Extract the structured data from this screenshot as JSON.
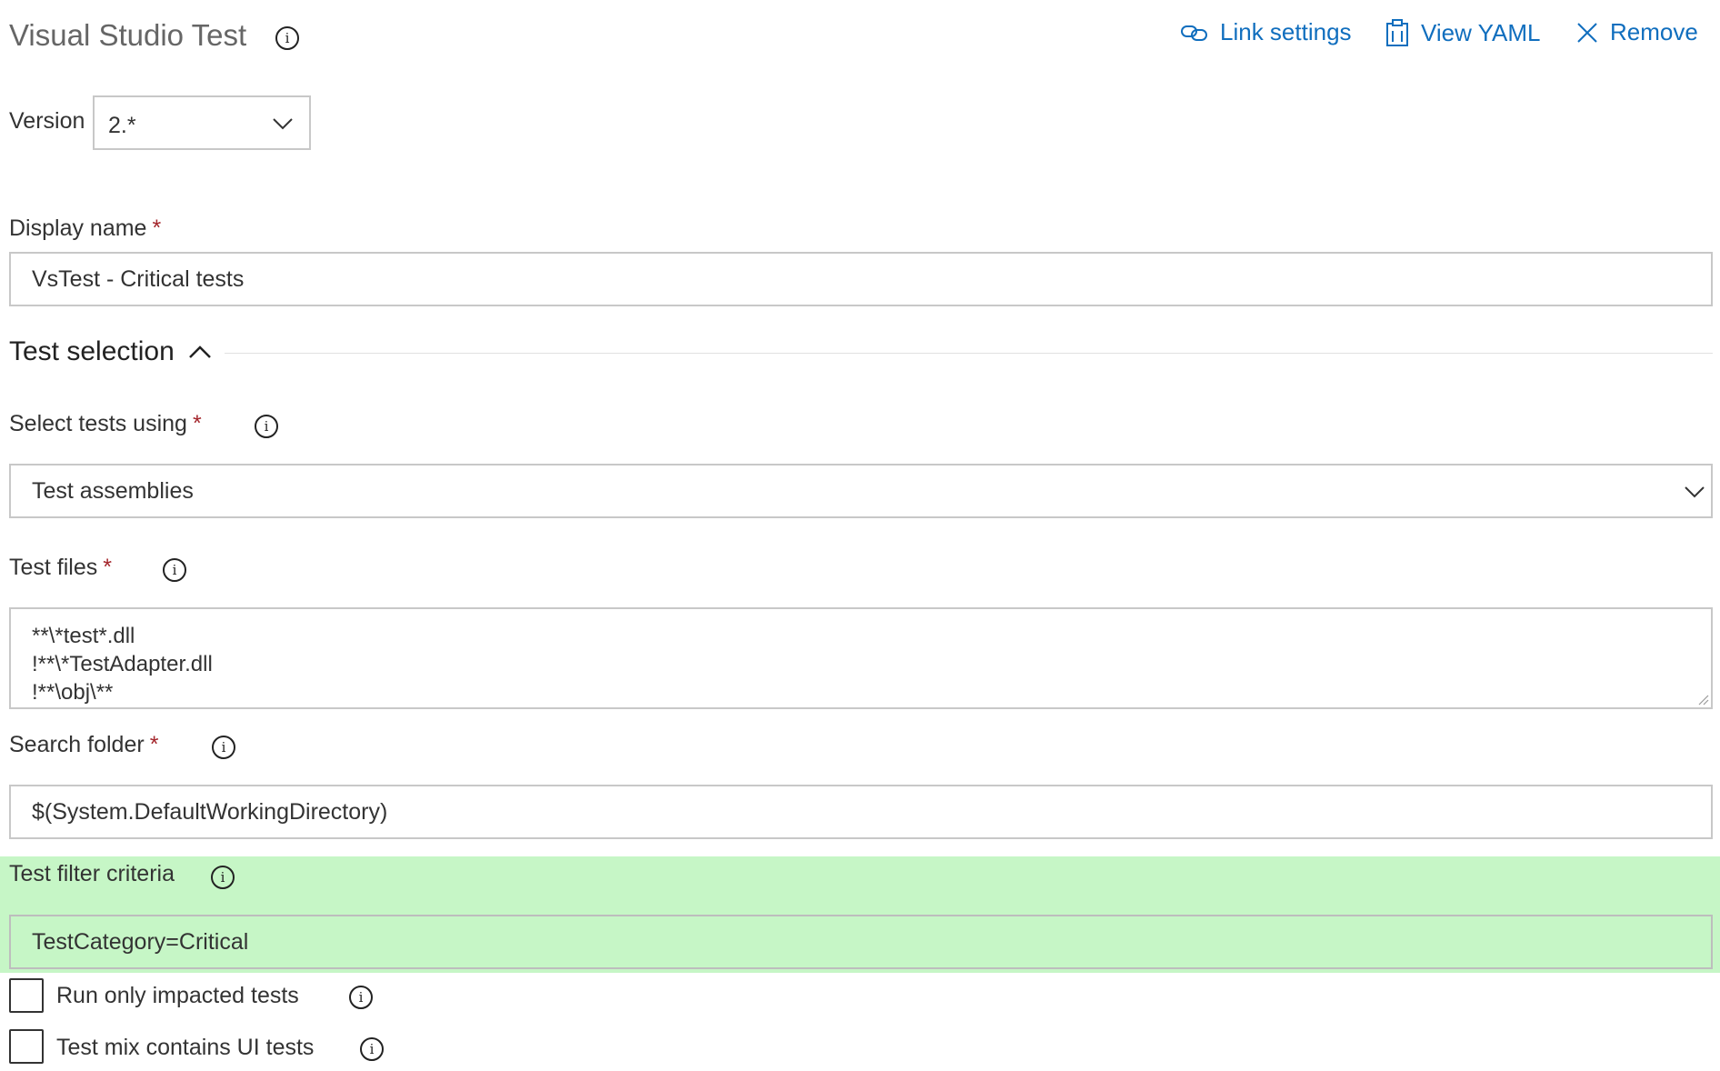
{
  "header": {
    "title": "Visual Studio Test",
    "actions": {
      "link_settings": "Link settings",
      "view_yaml": "View YAML",
      "remove": "Remove"
    }
  },
  "version": {
    "label": "Version",
    "value": "2.*"
  },
  "display_name": {
    "label": "Display name",
    "required": "*",
    "value": "VsTest - Critical tests"
  },
  "section": {
    "title": "Test selection"
  },
  "select_tests": {
    "label": "Select tests using",
    "required": "*",
    "value": "Test assemblies"
  },
  "test_files": {
    "label": "Test files",
    "required": "*",
    "lines": [
      "**\\*test*.dll",
      "!**\\*TestAdapter.dll",
      "!**\\obj\\**"
    ]
  },
  "search_folder": {
    "label": "Search folder",
    "required": "*",
    "value": "$(System.DefaultWorkingDirectory)"
  },
  "filter": {
    "label": "Test filter criteria",
    "value": "TestCategory=Critical",
    "highlight_color": "#c6f6c6"
  },
  "checkboxes": {
    "run_impacted": "Run only impacted tests",
    "ui_tests": "Test mix contains UI tests"
  },
  "colors": {
    "accent": "#106ebe",
    "required": "#a4262c"
  }
}
